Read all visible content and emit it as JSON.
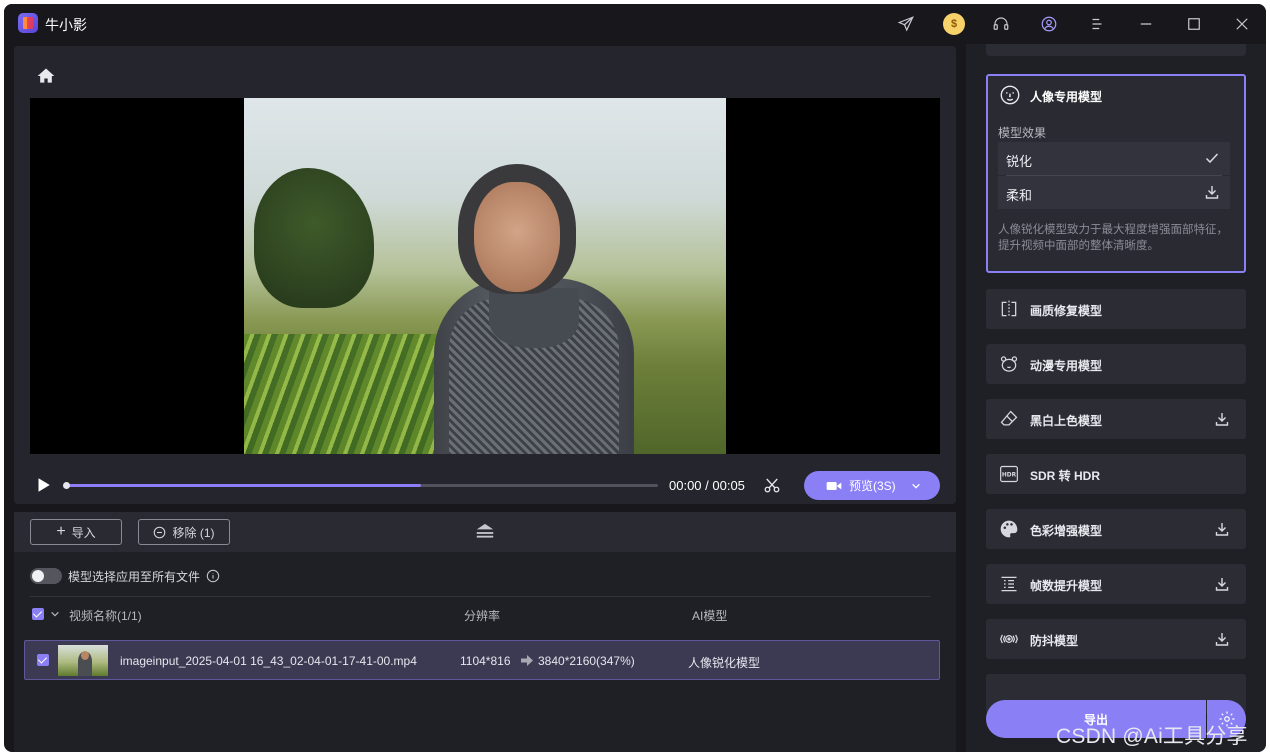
{
  "app": {
    "title": "牛小影"
  },
  "player": {
    "time_text": "00:00 / 00:05",
    "progress_fraction": 0.6,
    "preview_label": "预览(3S)"
  },
  "toolbar": {
    "import_label": "导入",
    "remove_label": "移除 (1)"
  },
  "apply_all": {
    "label": "模型选择应用至所有文件",
    "enabled": false
  },
  "table": {
    "headers": {
      "name": "视频名称(1/1)",
      "resolution": "分辨率",
      "model": "AI模型"
    },
    "rows": [
      {
        "filename": "imageinput_2025-04-01 16_43_02-04-01-17-41-00.mp4",
        "res_from": "1104*816",
        "res_to": "3840*2160(347%)",
        "model": "人像锐化模型",
        "checked": true
      }
    ]
  },
  "selected_model": {
    "title": "人像专用模型",
    "effect_label": "模型效果",
    "options": [
      {
        "label": "锐化",
        "state": "selected"
      },
      {
        "label": "柔和",
        "state": "download"
      }
    ],
    "description": "人像锐化模型致力于最大程度增强面部特征，提升视频中面部的整体清晰度。"
  },
  "models": [
    {
      "label": "画质修复模型",
      "icon": "split-frame-icon",
      "download": false
    },
    {
      "label": "动漫专用模型",
      "icon": "bear-face-icon",
      "download": false
    },
    {
      "label": "黑白上色模型",
      "icon": "eraser-icon",
      "download": true
    },
    {
      "label": "SDR 转 HDR",
      "icon": "hdr-icon",
      "download": false
    },
    {
      "label": "色彩增强模型",
      "icon": "palette-icon",
      "download": true
    },
    {
      "label": "帧数提升模型",
      "icon": "frames-icon",
      "download": true
    },
    {
      "label": "防抖模型",
      "icon": "stabilize-icon",
      "download": true
    }
  ],
  "export": {
    "label": "导出"
  },
  "watermark": "CSDN @Ai工具分享",
  "colors": {
    "accent": "#8a7ff5",
    "background": "#17171c",
    "panel": "#25252d"
  }
}
